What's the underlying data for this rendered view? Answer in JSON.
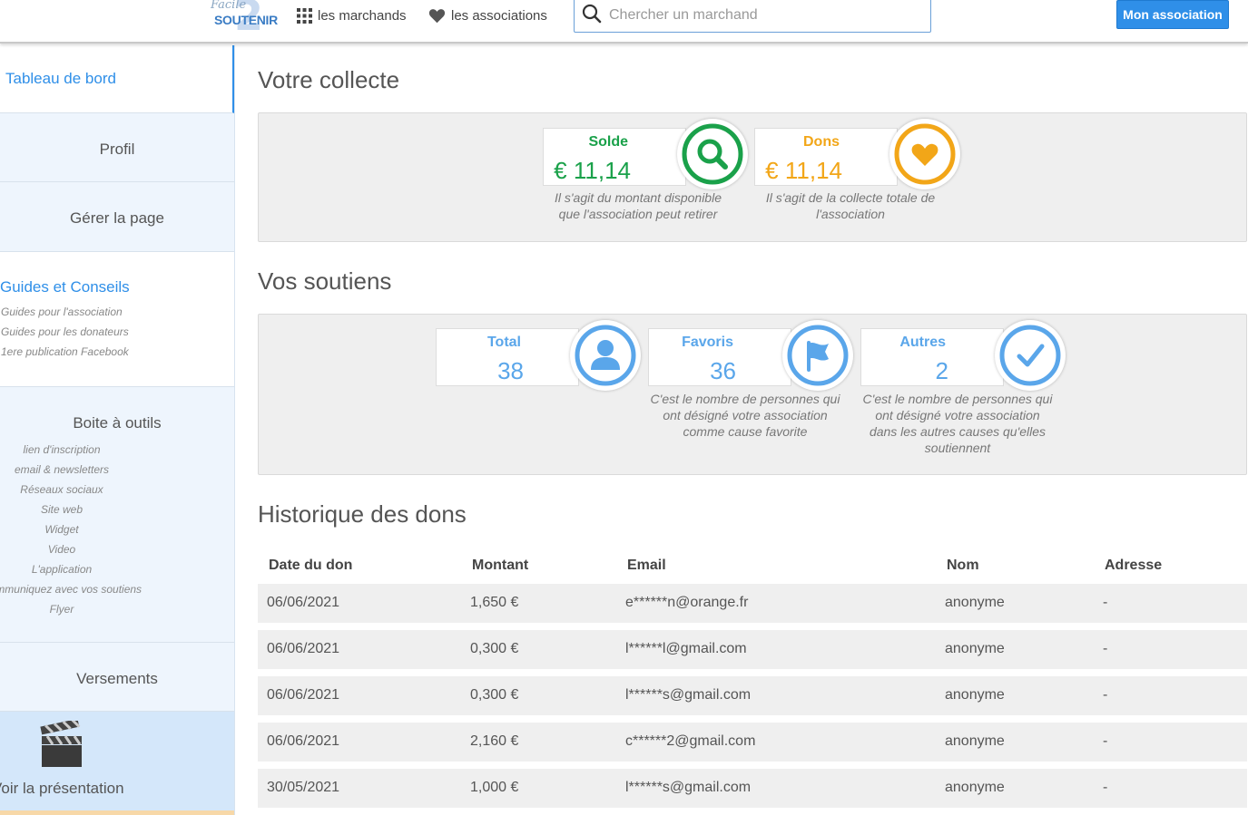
{
  "header": {
    "logo_top": "Facile",
    "logo_bottom": "SOUTENIR",
    "logo_digit": "2",
    "nav_merchants": "les marchands",
    "nav_associations": "les associations",
    "search_placeholder": "Chercher un marchand",
    "mon_association": "Mon association"
  },
  "sidebar": {
    "dashboard": "Tableau de bord",
    "profil": "Profil",
    "gerer": "Gérer la page",
    "guides_title": "Guides et Conseils",
    "guides": [
      "Guides pour l'association",
      "Guides pour les donateurs",
      "1ere publication Facebook"
    ],
    "boite_title": "Boite à outils",
    "boite": [
      "lien d'inscription",
      "email & newsletters",
      "Réseaux sociaux",
      "Site web",
      "Widget",
      "Video",
      "L'application",
      "Communiquez avec vos soutiens",
      "Flyer"
    ],
    "versements": "Versements",
    "presentation": "Voir la présentation"
  },
  "collecte": {
    "title": "Votre collecte",
    "solde": {
      "label": "Solde",
      "value": "€ 11,14",
      "desc": "Il s'agit du montant disponible que l'association peut retirer"
    },
    "dons": {
      "label": "Dons",
      "value": "€ 11,14",
      "desc": "Il s'agit de la collecte totale de l'association"
    }
  },
  "soutiens": {
    "title": "Vos soutiens",
    "total": {
      "label": "Total",
      "value": "38"
    },
    "favoris": {
      "label": "Favoris",
      "value": "36",
      "desc": "C'est le nombre de personnes qui ont désigné votre association comme cause favorite"
    },
    "autres": {
      "label": "Autres",
      "value": "2",
      "desc": "C'est le nombre de personnes qui ont désigné votre association dans les autres causes qu'elles soutiennent"
    }
  },
  "historique": {
    "title": "Historique des dons",
    "columns": [
      "Date du don",
      "Montant",
      "Email",
      "Nom",
      "Adresse"
    ],
    "rows": [
      [
        "06/06/2021",
        "1,650 €",
        "e******n@orange.fr",
        "anonyme",
        "-"
      ],
      [
        "06/06/2021",
        "0,300 €",
        "l******l@gmail.com",
        "anonyme",
        "-"
      ],
      [
        "06/06/2021",
        "0,300 €",
        "l******s@gmail.com",
        "anonyme",
        "-"
      ],
      [
        "06/06/2021",
        "2,160 €",
        "c******2@gmail.com",
        "anonyme",
        "-"
      ],
      [
        "30/05/2021",
        "1,000 €",
        "l******s@gmail.com",
        "anonyme",
        "-"
      ]
    ]
  },
  "colors": {
    "blue": "#2f8fe8",
    "green": "#1aa14a",
    "orange": "#f2a618",
    "light_blue": "#5aa6ea"
  }
}
